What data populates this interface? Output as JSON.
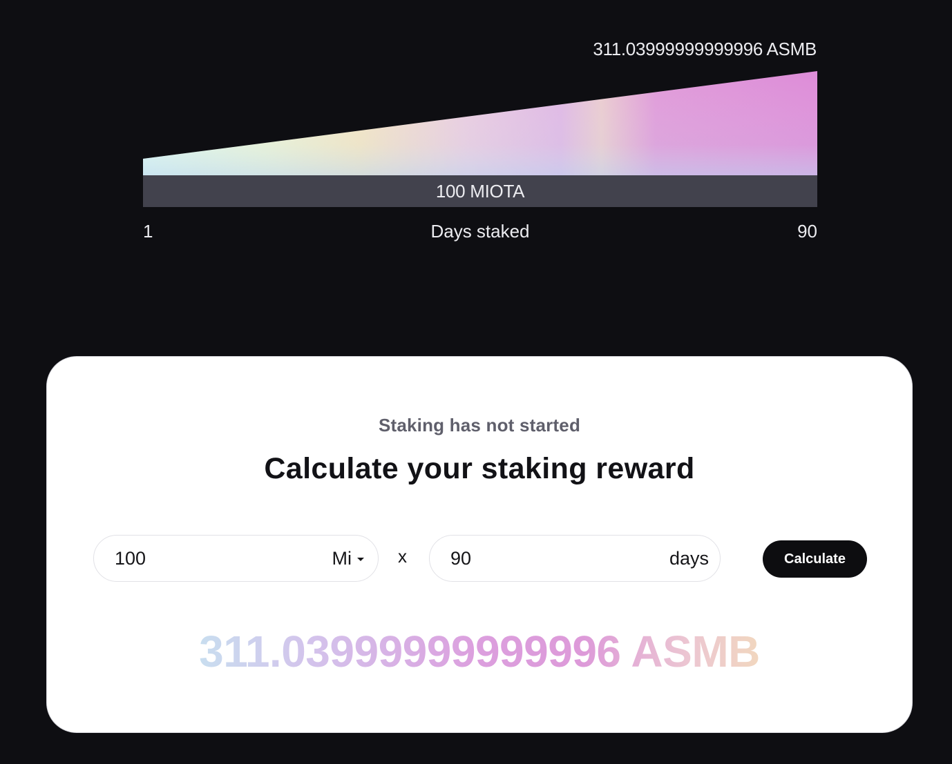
{
  "chart": {
    "top_label": "311.03999999999996 ASMB",
    "base_label": "100 MIOTA",
    "axis_start": "1",
    "axis_label": "Days staked",
    "axis_end": "90"
  },
  "chart_data": {
    "type": "area",
    "x": [
      1,
      90
    ],
    "y": [
      100,
      311.03999999999996
    ],
    "xlabel": "Days staked",
    "ylabel": ""
  },
  "card": {
    "status": "Staking has not started",
    "heading": "Calculate your staking reward",
    "amount": {
      "value": "100",
      "unit": "Mi"
    },
    "multiplier_symbol": "x",
    "days": {
      "value": "90",
      "unit": "days"
    },
    "calculate_label": "Calculate",
    "result": "311.03999999999996 ASMB"
  },
  "colors": {
    "background": "#0e0e12",
    "card": "#ffffff",
    "button": "#0d0d10",
    "bar": "#42424d"
  }
}
